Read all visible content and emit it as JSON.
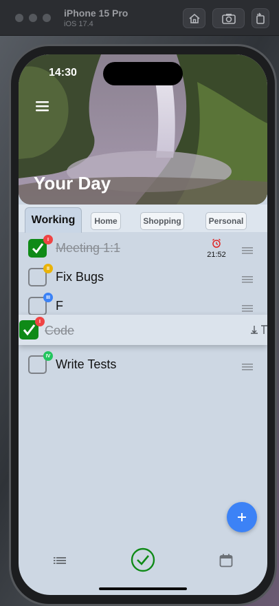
{
  "simulator": {
    "device_name": "iPhone 15 Pro",
    "os_version": "iOS 17.4"
  },
  "status_bar": {
    "time": "14:30"
  },
  "header": {
    "title": "Your Day"
  },
  "tabs": [
    {
      "label": "Working",
      "active": true
    },
    {
      "label": "Home",
      "active": false
    },
    {
      "label": "Shopping",
      "active": false
    },
    {
      "label": "Personal",
      "active": false
    }
  ],
  "tasks": [
    {
      "title": "Meeting 1:1",
      "done": true,
      "priority": "I",
      "priority_color": "#ef4444",
      "alarm_time": "21:52"
    },
    {
      "title": "Fix Bugs",
      "done": false,
      "priority": "II",
      "priority_color": "#eab308"
    },
    {
      "title": "F",
      "done": false,
      "priority": "III",
      "priority_color": "#3b82f6"
    },
    {
      "title": "Write Tests",
      "done": false,
      "priority": "IV",
      "priority_color": "#22c55e"
    }
  ],
  "dragging_task": {
    "title": "Code",
    "done": true,
    "priority": "I",
    "priority_color": "#ef4444"
  },
  "colors": {
    "accent": "#3c82f6",
    "done_green": "#0f8a17",
    "alarm_red": "#e02424"
  },
  "icons": {
    "menu": "hamburger-icon",
    "fab": "plus-icon",
    "nav_left": "list-icon",
    "nav_center": "check-circle-icon",
    "nav_right": "calendar-icon",
    "alarm": "alarm-clock-icon"
  }
}
